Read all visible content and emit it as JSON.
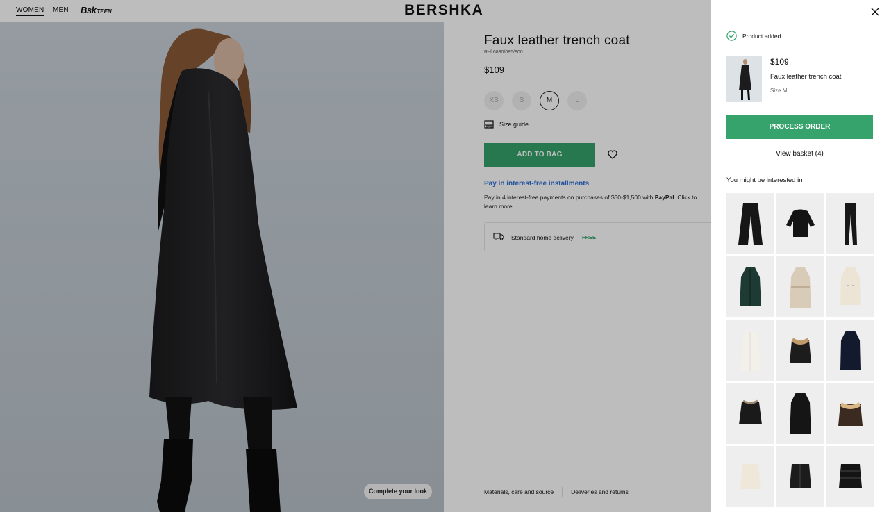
{
  "header": {
    "nav": [
      "WOMEN",
      "MEN"
    ],
    "teen_logo": {
      "bsk": "Bsk",
      "teen": "TEEN"
    },
    "logo": "BERSHKA"
  },
  "hero": {
    "complete_look_label": "Complete your look"
  },
  "product": {
    "title": "Faux leather trench coat",
    "ref": "Ref 6830/085/800",
    "price": "$109",
    "sizes": [
      {
        "label": "XS",
        "selected": false
      },
      {
        "label": "S",
        "selected": false
      },
      {
        "label": "M",
        "selected": true
      },
      {
        "label": "L",
        "selected": false
      }
    ],
    "size_guide_label": "Size guide",
    "add_to_bag_label": "ADD TO BAG",
    "pay_link": "Pay in interest-free installments",
    "pay_text_1": "Pay in 4 interest-free payments on purchases of $30-$1,500 with ",
    "pay_brand": "PayPal",
    "pay_text_2": ". Click to learn more",
    "delivery_label": "Standard home delivery",
    "delivery_price": "FREE",
    "bottom_links": [
      "Materials, care and source",
      "Deliveries and returns"
    ]
  },
  "drawer": {
    "added_label": "Product added",
    "item": {
      "price": "$109",
      "name": "Faux leather trench coat",
      "size": "Size M"
    },
    "process_label": "PROCESS ORDER",
    "view_basket_label": "View basket (4)",
    "interested_label": "You might be interested in",
    "recommendations": [
      {
        "icon": "wide-black-trousers-icon"
      },
      {
        "icon": "black-sweater-icon"
      },
      {
        "icon": "black-leggings-icon"
      },
      {
        "icon": "green-patent-coat-icon"
      },
      {
        "icon": "beige-trench-coat-icon"
      },
      {
        "icon": "cream-double-breasted-coat-icon"
      },
      {
        "icon": "white-long-coat-icon"
      },
      {
        "icon": "shearling-collar-jacket-icon"
      },
      {
        "icon": "navy-long-coat-icon"
      },
      {
        "icon": "black-aviator-jacket-icon"
      },
      {
        "icon": "black-long-coat-icon"
      },
      {
        "icon": "brown-aviator-jacket-icon"
      },
      {
        "icon": "cream-jacket-icon"
      },
      {
        "icon": "black-leather-jacket-icon"
      },
      {
        "icon": "black-puffer-jacket-icon"
      }
    ]
  },
  "colors": {
    "accent": "#35a36b",
    "link": "#2f6ed8"
  }
}
